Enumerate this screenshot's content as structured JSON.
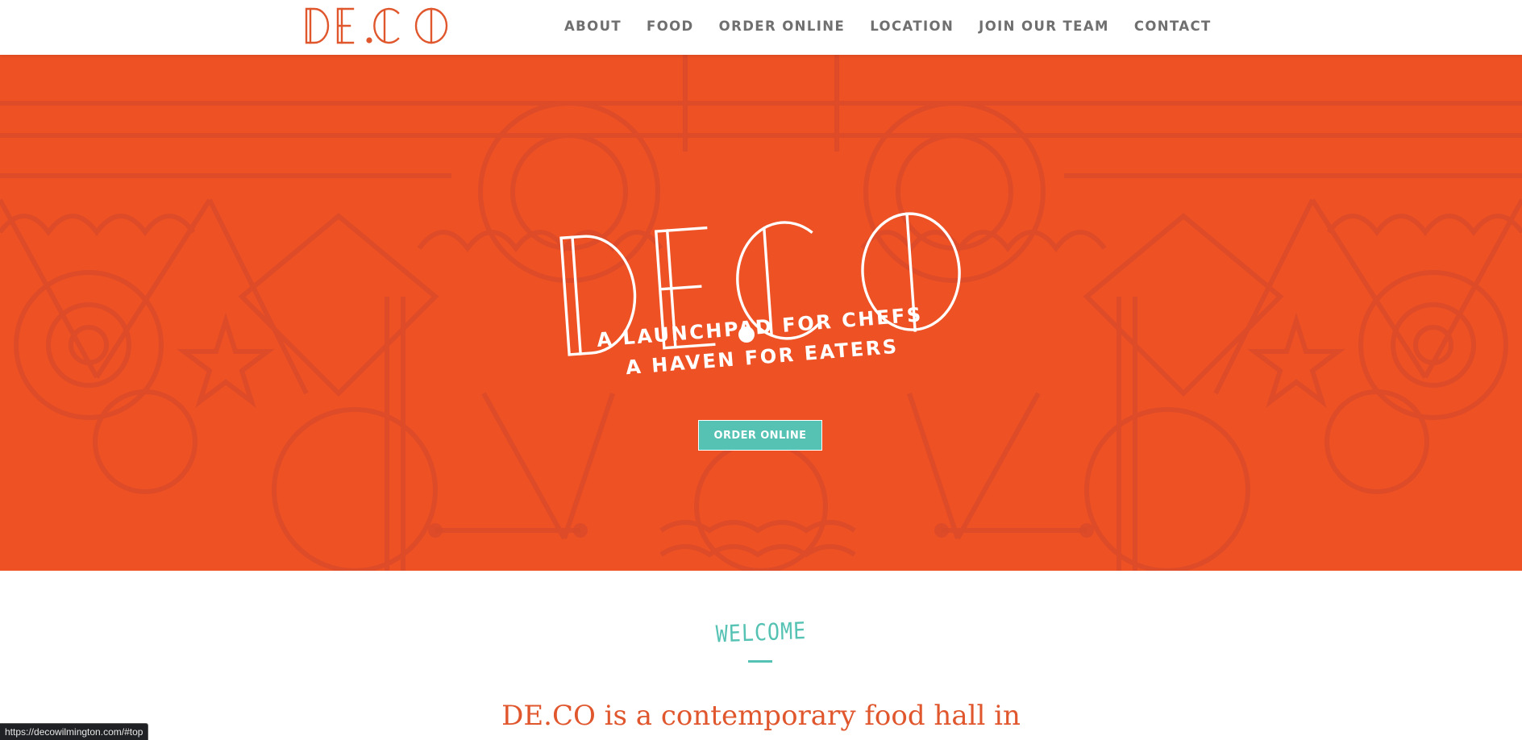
{
  "brand": {
    "logo_text": "DE.CO",
    "logo_color": "#e0562d",
    "accent_teal": "#55c2b3",
    "hero_orange": "#ee5124"
  },
  "nav": {
    "items": [
      {
        "label": "ABOUT"
      },
      {
        "label": "FOOD"
      },
      {
        "label": "ORDER ONLINE"
      },
      {
        "label": "LOCATION"
      },
      {
        "label": "JOIN OUR TEAM"
      },
      {
        "label": "CONTACT"
      }
    ]
  },
  "hero": {
    "wordmark": "DE.CO",
    "tagline_line1": "A LAUNCHPAD FOR CHEFS",
    "tagline_line2": "A HAVEN FOR EATERS",
    "cta_label": "ORDER ONLINE"
  },
  "welcome": {
    "label": "WELCOME",
    "headline": "DE.CO is a contemporary food hall in"
  },
  "status_bar": {
    "url": "https://decowilmington.com/#top"
  }
}
